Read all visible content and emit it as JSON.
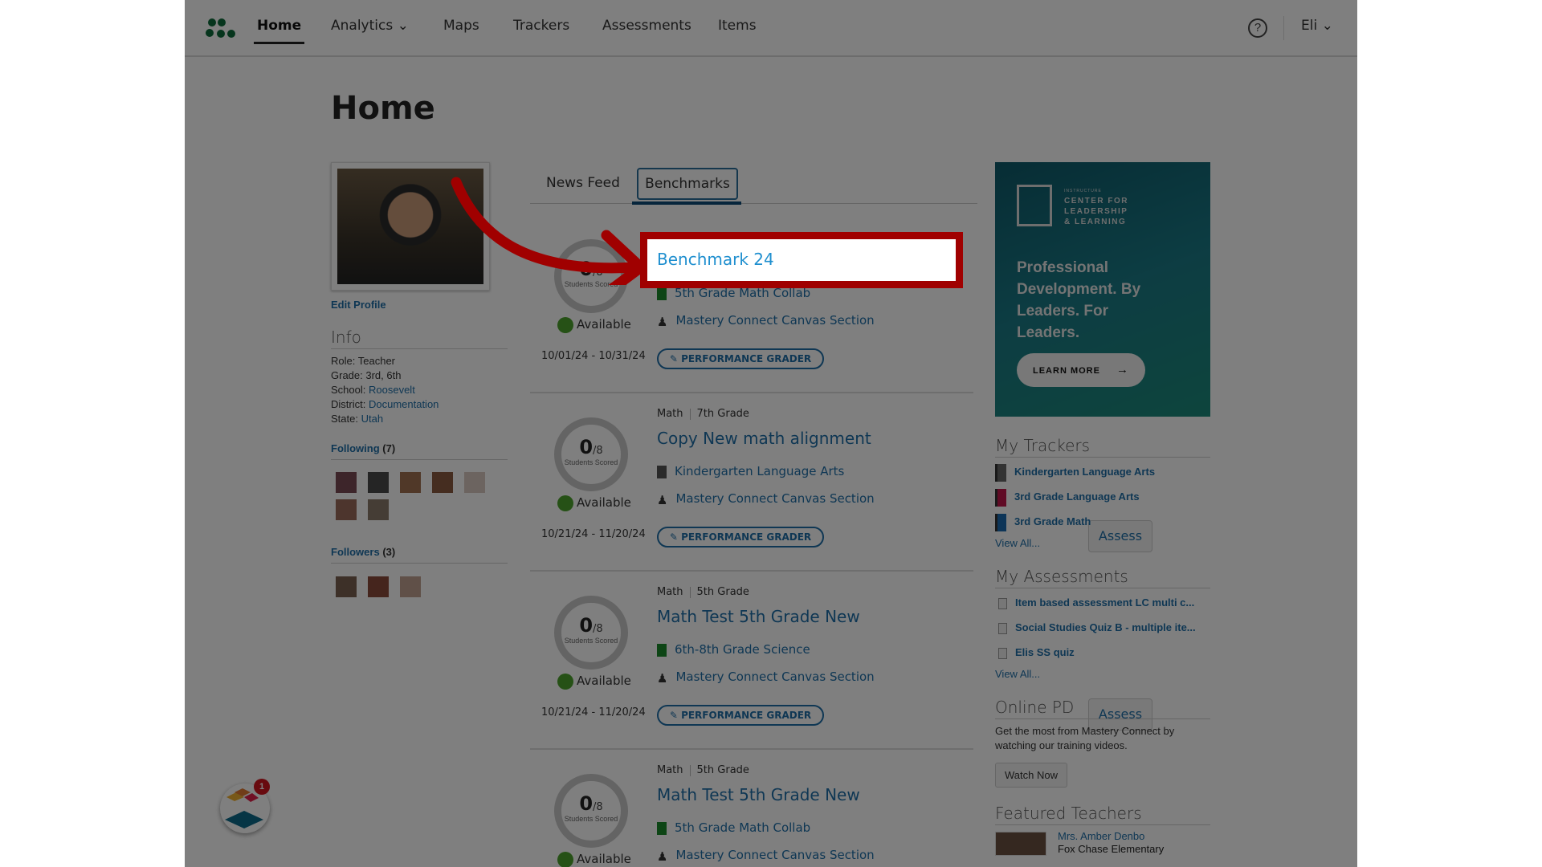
{
  "nav": {
    "items": [
      {
        "label": "Home",
        "active": true
      },
      {
        "label": "Analytics",
        "dropdown": true
      },
      {
        "label": "Maps"
      },
      {
        "label": "Trackers"
      },
      {
        "label": "Assessments"
      },
      {
        "label": "Items"
      }
    ],
    "user": "Eli",
    "help_icon": "question-circle-icon"
  },
  "page": {
    "title": "Home"
  },
  "profile": {
    "edit_label": "Edit Profile",
    "info_heading": "Info",
    "info": [
      {
        "k": "Role:",
        "v": "Teacher",
        "link": false
      },
      {
        "k": "Grade:",
        "v": "3rd, 6th",
        "link": false
      },
      {
        "k": "School:",
        "v": "Roosevelt",
        "link": true
      },
      {
        "k": "District:",
        "v": "Documentation",
        "link": true
      },
      {
        "k": "State:",
        "v": "Utah",
        "link": true
      }
    ],
    "following_label": "Following",
    "following_count": "(7)",
    "followers_label": "Followers",
    "followers_count": "(3)"
  },
  "tabs": [
    {
      "label": "News Feed",
      "active": false
    },
    {
      "label": "Benchmarks",
      "active": true
    }
  ],
  "highlight": {
    "label": "Benchmark 24",
    "color": "#a00000"
  },
  "cards": [
    {
      "subject": "",
      "grade": "",
      "title": "Benchmark 24",
      "scored": "0",
      "total": "/8",
      "scored_label": "Students Scored",
      "status": "Available",
      "dates": "10/01/24 - 10/31/24",
      "tracker": "5th Grade Math Collab",
      "tracker_color": "#1a8a2a",
      "section": "Mastery Connect Canvas Section",
      "grader": "PERFORMANCE GRADER",
      "assess": "Assess"
    },
    {
      "subject": "Math",
      "grade": "7th Grade",
      "title": "Copy New math alignment",
      "scored": "0",
      "total": "/8",
      "scored_label": "Students Scored",
      "status": "Available",
      "dates": "10/21/24 - 11/20/24",
      "tracker": "Kindergarten Language Arts",
      "tracker_color": "#555555",
      "section": "Mastery Connect Canvas Section",
      "grader": "PERFORMANCE GRADER",
      "assess": "Assess"
    },
    {
      "subject": "Math",
      "grade": "5th Grade",
      "title": "Math Test 5th Grade New",
      "scored": "0",
      "total": "/8",
      "scored_label": "Students Scored",
      "status": "Available",
      "dates": "10/21/24 - 11/20/24",
      "tracker": "6th-8th Grade Science",
      "tracker_color": "#1a8a2a",
      "section": "Mastery Connect Canvas Section",
      "grader": "PERFORMANCE GRADER",
      "assess": "Assess"
    },
    {
      "subject": "Math",
      "grade": "5th Grade",
      "title": "Math Test 5th Grade New",
      "scored": "0",
      "total": "/8",
      "scored_label": "Students Scored",
      "status": "Available",
      "dates": "",
      "tracker": "5th Grade Math Collab",
      "tracker_color": "#1a8a2a",
      "section": "Mastery Connect Canvas Section",
      "grader": "",
      "assess": ""
    }
  ],
  "ad": {
    "brand_small": "INSTRUCTURE",
    "brand": "CENTER FOR LEADERSHIP & LEARNING",
    "headline": "Professional Development. By Leaders. For Leaders.",
    "cta": "LEARN MORE"
  },
  "trackers": {
    "heading": "My Trackers",
    "items": [
      {
        "label": "Kindergarten Language Arts",
        "color": "#666666"
      },
      {
        "label": "3rd Grade Language Arts",
        "color": "#c0174a"
      },
      {
        "label": "3rd Grade Math",
        "color": "#1a6ab0"
      }
    ],
    "view_all": "View All..."
  },
  "assessments": {
    "heading": "My Assessments",
    "items": [
      "Item based assessment LC multi c...",
      "Social Studies Quiz B - multiple ite...",
      "Elis SS quiz"
    ],
    "view_all": "View All..."
  },
  "online_pd": {
    "heading": "Online PD",
    "text": "Get the most from Mastery Connect by watching our training videos.",
    "button": "Watch Now"
  },
  "featured": {
    "heading": "Featured Teachers",
    "name": "Mrs. Amber Denbo",
    "school": "Fox Chase Elementary"
  },
  "widget": {
    "badge": "1"
  }
}
